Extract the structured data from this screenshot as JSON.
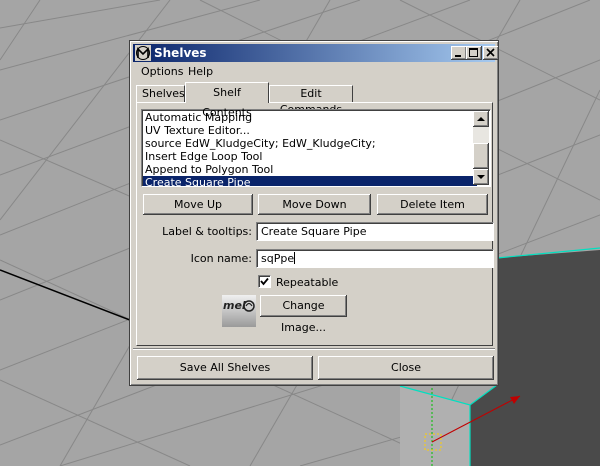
{
  "window": {
    "title": "Shelves"
  },
  "menu": [
    "Options",
    "Help"
  ],
  "tabs": [
    {
      "label": "Shelves"
    },
    {
      "label": "Shelf Contents"
    },
    {
      "label": "Edit Commands"
    }
  ],
  "list": {
    "items": [
      "Automatic Mapping",
      "UV Texture Editor...",
      "source EdW_KludgeCity; EdW_KludgeCity;",
      "Insert Edge Loop Tool",
      "Append to Polygon Tool",
      "Create Square Pipe"
    ],
    "selected": "Create Square Pipe"
  },
  "buttons": {
    "move_up": "Move Up",
    "move_down": "Move Down",
    "delete_item": "Delete Item",
    "change_image": "Change Image...",
    "save_all": "Save All Shelves",
    "close": "Close"
  },
  "fields": {
    "label_tooltips": {
      "label": "Label & tooltips:",
      "value": "Create Square Pipe"
    },
    "icon_name": {
      "label": "Icon name:",
      "value": "sqPpe"
    }
  },
  "repeatable": {
    "label": "Repeatable",
    "checked": true
  },
  "icon": {
    "name": "mel-icon",
    "text": "mel"
  },
  "colors": {
    "titlebar_start": "#0a246a",
    "titlebar_end": "#a6caf0",
    "selection": "#0a246a",
    "viewport_edge": "#00e0c0"
  }
}
